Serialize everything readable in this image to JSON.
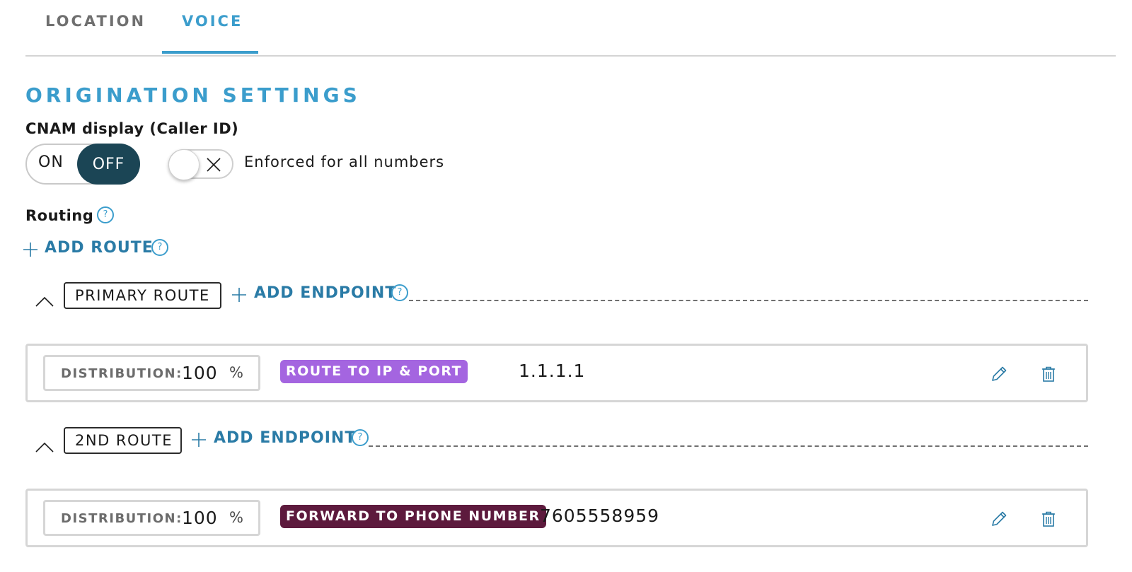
{
  "colors": {
    "accent": "#3b9dcc",
    "link": "#2a7ba6",
    "toggle_active": "#1b4555",
    "badge_ip": "#a465e0",
    "badge_phone": "#5d1a3d"
  },
  "tabs": [
    {
      "label": "LOCATION",
      "active": false
    },
    {
      "label": "VOICE",
      "active": true
    }
  ],
  "section": {
    "title": "ORIGINATION SETTINGS"
  },
  "cnam": {
    "label": "CNAM display (Caller ID)",
    "on_label": "ON",
    "off_label": "OFF",
    "selected": "OFF",
    "enforce_switch_on": false,
    "enforce_label": "Enforced for all numbers"
  },
  "routing": {
    "label": "Routing",
    "help_symbol": "?",
    "add_route_label": "ADD ROUTE",
    "add_endpoint_label": "ADD ENDPOINT",
    "routes": [
      {
        "name": "PRIMARY ROUTE",
        "endpoint": {
          "distribution_label": "DISTRIBUTION:",
          "distribution_value": "100",
          "percent": "%",
          "type": "ROUTE TO IP & PORT",
          "value": "1.1.1.1"
        }
      },
      {
        "name": "2ND ROUTE",
        "endpoint": {
          "distribution_label": "DISTRIBUTION:",
          "distribution_value": "100",
          "percent": "%",
          "type": "FORWARD TO PHONE NUMBER",
          "value": "7605558959"
        }
      }
    ]
  },
  "icons": {
    "add": "plus-icon",
    "help": "question-circle-icon",
    "collapse": "chevron-up-icon",
    "edit": "pencil-icon",
    "delete": "trash-icon",
    "switch_off": "x-icon"
  }
}
